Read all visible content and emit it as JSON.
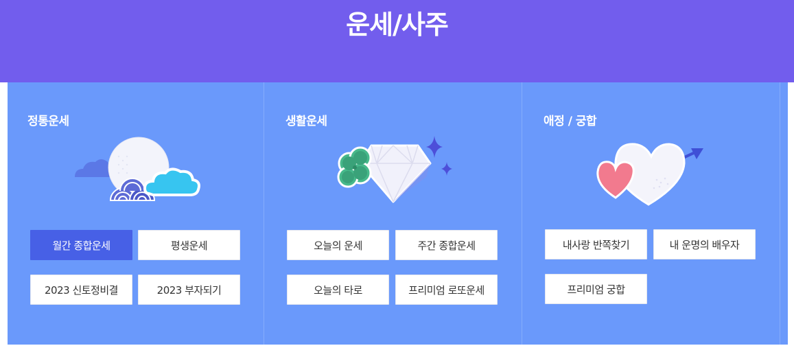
{
  "header": {
    "title": "운세/사주"
  },
  "sections": [
    {
      "title": "정통운세",
      "illustration": "moon-cloud-wave-icon",
      "buttons": [
        {
          "label": "월간 종합운세",
          "active": true
        },
        {
          "label": "평생운세",
          "active": false
        },
        {
          "label": "2023 신토정비결",
          "active": false
        },
        {
          "label": "2023 부자되기",
          "active": false
        }
      ]
    },
    {
      "title": "생활운세",
      "illustration": "clover-diamond-icon",
      "buttons": [
        {
          "label": "오늘의 운세",
          "active": false
        },
        {
          "label": "주간 종합운세",
          "active": false
        },
        {
          "label": "오늘의 타로",
          "active": false
        },
        {
          "label": "프리미엄 로또운세",
          "active": false
        }
      ]
    },
    {
      "title": "애정 / 궁합",
      "illustration": "hearts-arrow-icon",
      "buttons": [
        {
          "label": "내사랑 반쪽찾기",
          "active": false
        },
        {
          "label": "내 운명의 배우자",
          "active": false
        },
        {
          "label": "프리미엄 궁합",
          "active": false
        }
      ]
    }
  ],
  "colors": {
    "header_bg": "#725ded",
    "panel_bg": "#6a99fb",
    "active_button": "#4760e6"
  }
}
